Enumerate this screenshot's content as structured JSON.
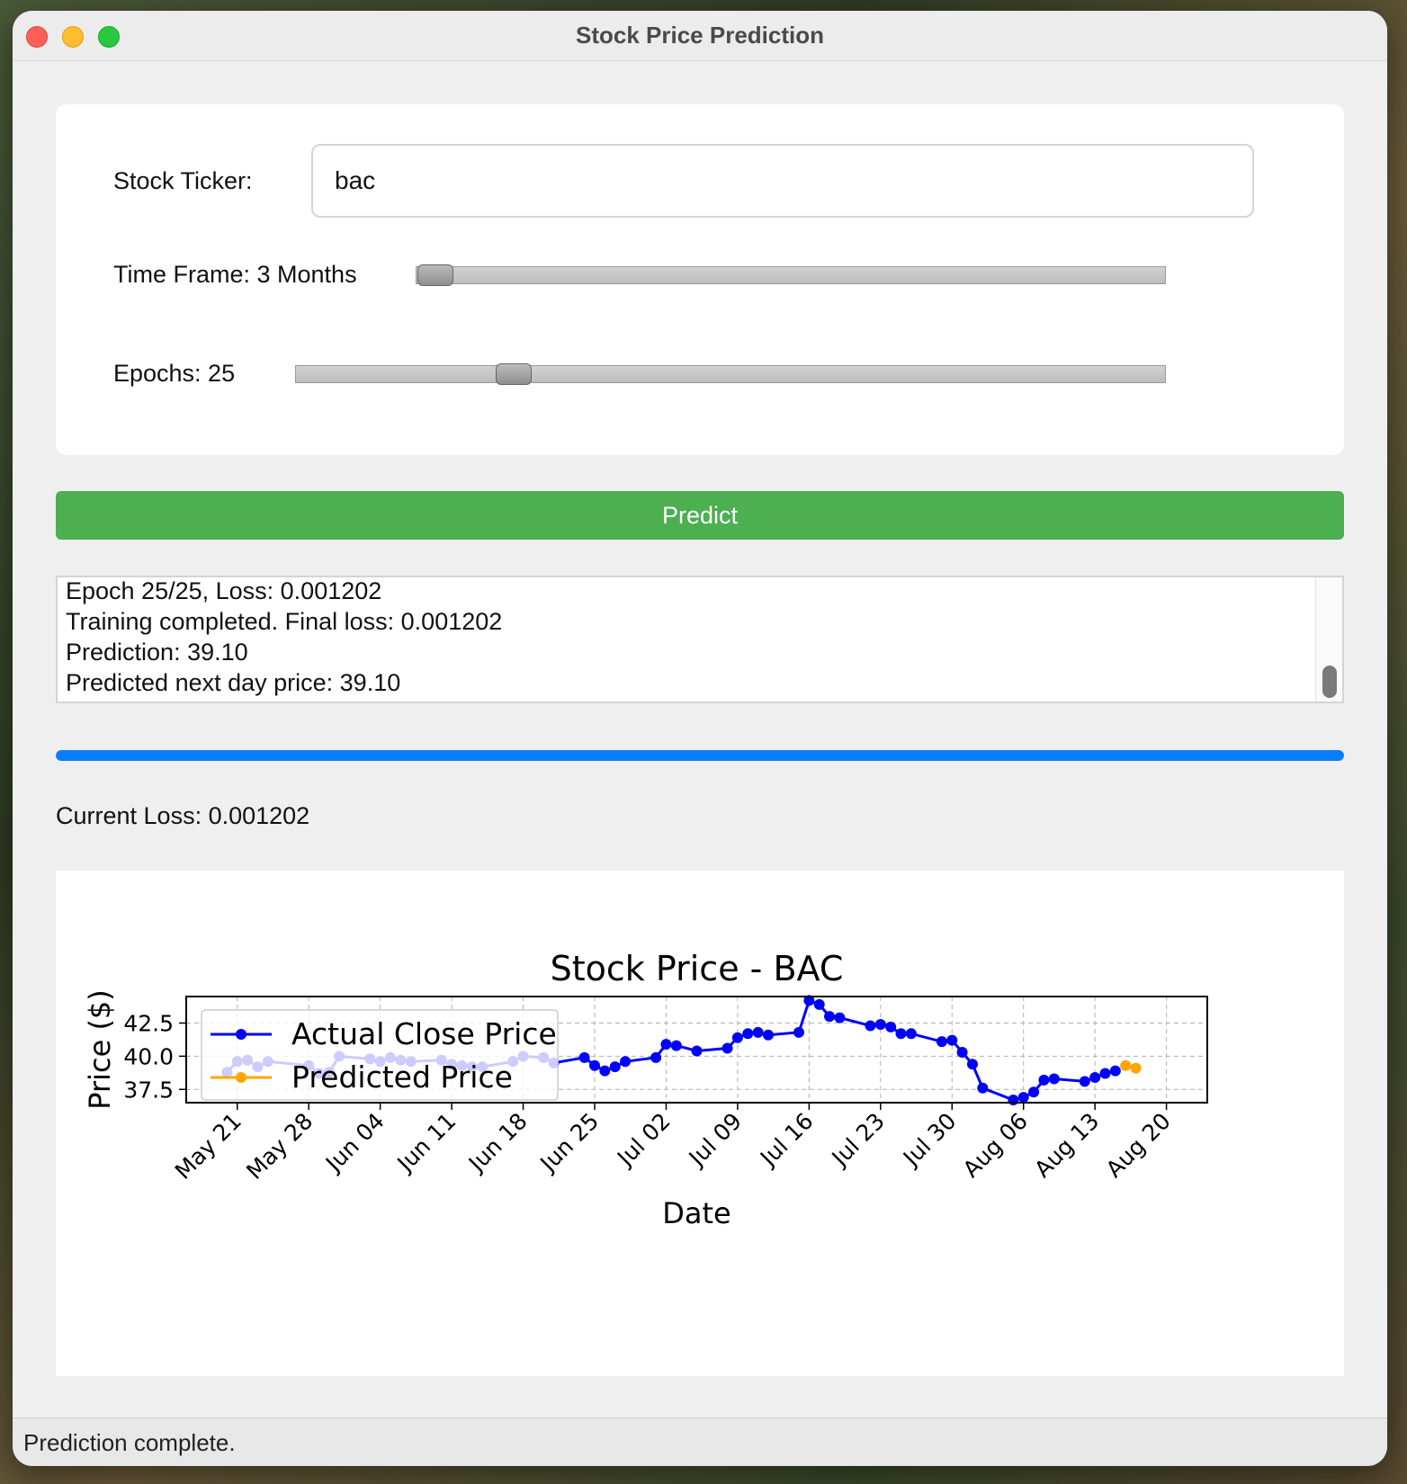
{
  "window": {
    "title": "Stock Price Prediction"
  },
  "form": {
    "ticker_label": "Stock Ticker:",
    "ticker_value": "bac",
    "timeframe_label": "Time Frame: 3 Months",
    "timeframe_fraction": 0.025,
    "epochs_label": "Epochs: 25",
    "epochs_fraction": 0.25
  },
  "predict_button": {
    "label": "Predict"
  },
  "log": {
    "lines": [
      "Epoch 25/25, Loss: 0.001202",
      "Training completed. Final loss: 0.001202",
      "Prediction: 39.10",
      "Predicted next day price: 39.10"
    ]
  },
  "progress": {
    "percent": 100,
    "color": "#0a7cff"
  },
  "current_loss_label": "Current Loss: 0.001202",
  "status": {
    "text": "Prediction complete."
  },
  "colors": {
    "predict_button": "#4caf50",
    "actual_series": "#0000ff",
    "predicted_series": "#ffa500"
  },
  "chart_data": {
    "type": "line",
    "title": "Stock Price - BAC",
    "xlabel": "Date",
    "ylabel": "Price ($)",
    "x_ticks": [
      "May 21",
      "May 28",
      "Jun 04",
      "Jun 11",
      "Jun 18",
      "Jun 25",
      "Jul 02",
      "Jul 09",
      "Jul 16",
      "Jul 23",
      "Jul 30",
      "Aug 06",
      "Aug 13",
      "Aug 20"
    ],
    "y_ticks": [
      "37.5",
      "40.0",
      "42.5"
    ],
    "xlim": [
      "2024-05-16",
      "2024-08-24"
    ],
    "ylim": [
      36.5,
      44.5
    ],
    "grid": true,
    "legend": "upper-left",
    "series": [
      {
        "name": "Actual Close Price",
        "color": "#0000ff",
        "points": [
          [
            "2024-05-20",
            38.8
          ],
          [
            "2024-05-21",
            39.6
          ],
          [
            "2024-05-22",
            39.7
          ],
          [
            "2024-05-23",
            39.2
          ],
          [
            "2024-05-24",
            39.6
          ],
          [
            "2024-05-28",
            39.3
          ],
          [
            "2024-05-29",
            38.7
          ],
          [
            "2024-05-30",
            38.8
          ],
          [
            "2024-05-31",
            40.0
          ],
          [
            "2024-06-03",
            39.8
          ],
          [
            "2024-06-04",
            39.6
          ],
          [
            "2024-06-05",
            39.9
          ],
          [
            "2024-06-06",
            39.7
          ],
          [
            "2024-06-07",
            39.6
          ],
          [
            "2024-06-10",
            39.7
          ],
          [
            "2024-06-11",
            39.4
          ],
          [
            "2024-06-12",
            39.3
          ],
          [
            "2024-06-13",
            39.2
          ],
          [
            "2024-06-14",
            39.2
          ],
          [
            "2024-06-17",
            39.6
          ],
          [
            "2024-06-18",
            40.0
          ],
          [
            "2024-06-20",
            39.9
          ],
          [
            "2024-06-21",
            39.5
          ],
          [
            "2024-06-24",
            39.9
          ],
          [
            "2024-06-25",
            39.3
          ],
          [
            "2024-06-26",
            38.9
          ],
          [
            "2024-06-27",
            39.2
          ],
          [
            "2024-06-28",
            39.6
          ],
          [
            "2024-07-01",
            39.9
          ],
          [
            "2024-07-02",
            40.9
          ],
          [
            "2024-07-03",
            40.8
          ],
          [
            "2024-07-05",
            40.4
          ],
          [
            "2024-07-08",
            40.6
          ],
          [
            "2024-07-09",
            41.4
          ],
          [
            "2024-07-10",
            41.7
          ],
          [
            "2024-07-11",
            41.8
          ],
          [
            "2024-07-12",
            41.6
          ],
          [
            "2024-07-15",
            41.8
          ],
          [
            "2024-07-16",
            44.2
          ],
          [
            "2024-07-17",
            43.9
          ],
          [
            "2024-07-18",
            43.0
          ],
          [
            "2024-07-19",
            42.9
          ],
          [
            "2024-07-22",
            42.3
          ],
          [
            "2024-07-23",
            42.4
          ],
          [
            "2024-07-24",
            42.2
          ],
          [
            "2024-07-25",
            41.7
          ],
          [
            "2024-07-26",
            41.7
          ],
          [
            "2024-07-29",
            41.1
          ],
          [
            "2024-07-30",
            41.2
          ],
          [
            "2024-07-31",
            40.3
          ],
          [
            "2024-08-01",
            39.4
          ],
          [
            "2024-08-02",
            37.6
          ],
          [
            "2024-08-05",
            36.7
          ],
          [
            "2024-08-06",
            36.9
          ],
          [
            "2024-08-07",
            37.3
          ],
          [
            "2024-08-08",
            38.2
          ],
          [
            "2024-08-09",
            38.3
          ],
          [
            "2024-08-12",
            38.1
          ],
          [
            "2024-08-13",
            38.4
          ],
          [
            "2024-08-14",
            38.7
          ],
          [
            "2024-08-15",
            38.9
          ]
        ]
      },
      {
        "name": "Predicted Price",
        "color": "#ffa500",
        "points": [
          [
            "2024-08-16",
            39.3
          ],
          [
            "2024-08-17",
            39.1
          ]
        ]
      }
    ]
  }
}
